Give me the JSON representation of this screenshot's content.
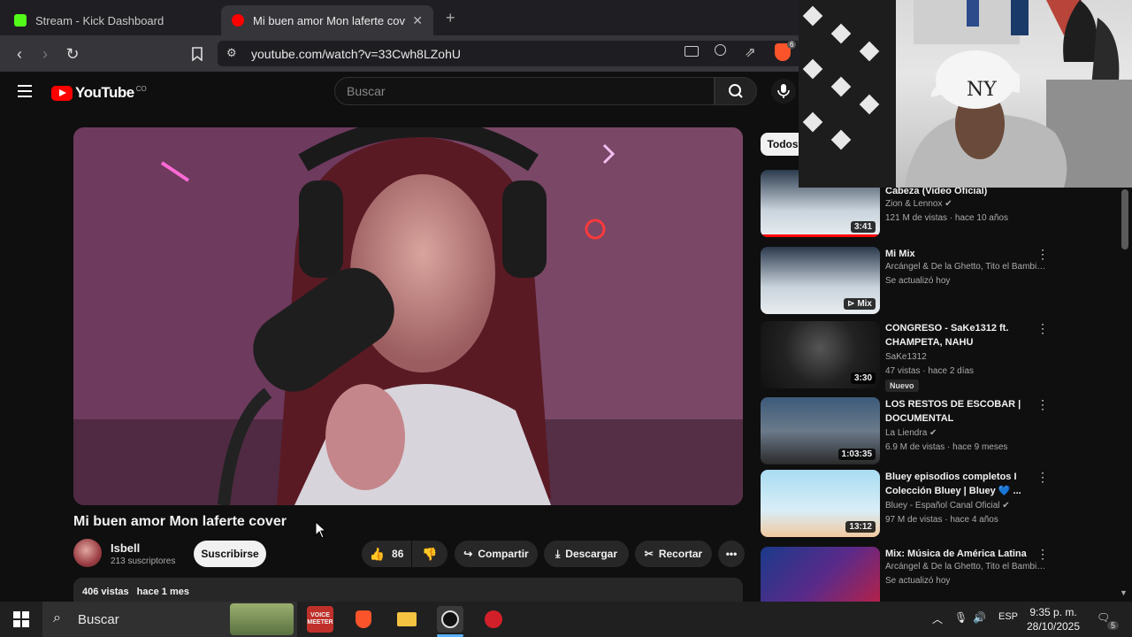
{
  "browser": {
    "tabs": [
      {
        "label": "Stream - Kick Dashboard",
        "active": false,
        "favicon_color": "#53fc18"
      },
      {
        "label": "Mi buen amor Mon lafertе cover",
        "active": true,
        "favicon_color": "#ff0000"
      }
    ],
    "url": "youtube.com/watch?v=33Cwh8LZohU",
    "extension_badge": "6"
  },
  "youtube": {
    "logo_text": "YouTube",
    "country_code": "CO",
    "search_placeholder": "Buscar",
    "video": {
      "title": "Mi buen amor Mon laferte cover",
      "channel": "Isbell",
      "subscribers": "213 suscriptores",
      "subscribe_label": "Suscribirse",
      "likes": "86",
      "share_label": "Compartir",
      "download_label": "Descargar",
      "clip_label": "Recortar",
      "views": "406 vistas",
      "age": "hace 1 mes"
    },
    "filter_chip": "Todos",
    "recommendations": [
      {
        "title": "Cabeza (Video Oficial)",
        "channel": "Zion & Lennox",
        "verified": true,
        "meta": "121 M de vistas · hace 10 años",
        "duration": "3:41"
      },
      {
        "title": "Mi Mix",
        "channel": "Arcángel & De la Ghetto, Tito el Bambino,...",
        "verified": false,
        "meta": "Se actualizó hoy",
        "duration": "Mix"
      },
      {
        "title": "CONGRESO - SaKe1312 ft. CHAMPETA, NAHU",
        "channel": "SaKe1312",
        "verified": false,
        "meta": "47 vistas · hace 2 días",
        "badge": "Nuevo",
        "duration": "3:30"
      },
      {
        "title": "LOS RESTOS DE ESCOBAR | DOCUMENTAL",
        "channel": "La Liendra",
        "verified": true,
        "meta": "6.9 M de vistas · hace 9 meses",
        "duration": "1:03:35"
      },
      {
        "title": "Bluey episodios completos I Colección Bluey | Bluey 💙 ...",
        "channel": "Bluey - Español Canal Oficial",
        "verified": true,
        "meta": "97 M de vistas · hace 4 años",
        "duration": "13:12"
      },
      {
        "title": "Mix: Música de América Latina",
        "channel": "Arcángel & De la Ghetto, Tito el Bambino,...",
        "verified": false,
        "meta": "Se actualizó hoy",
        "duration": ""
      }
    ]
  },
  "taskbar": {
    "search_placeholder": "Buscar",
    "language": "ESP",
    "time": "9:35 p. m.",
    "date": "28/10/2025",
    "notification_count": "5"
  },
  "colors": {
    "brand_red": "#ff0000",
    "bg": "#0f0f0f",
    "kick_green": "#53fc18"
  }
}
